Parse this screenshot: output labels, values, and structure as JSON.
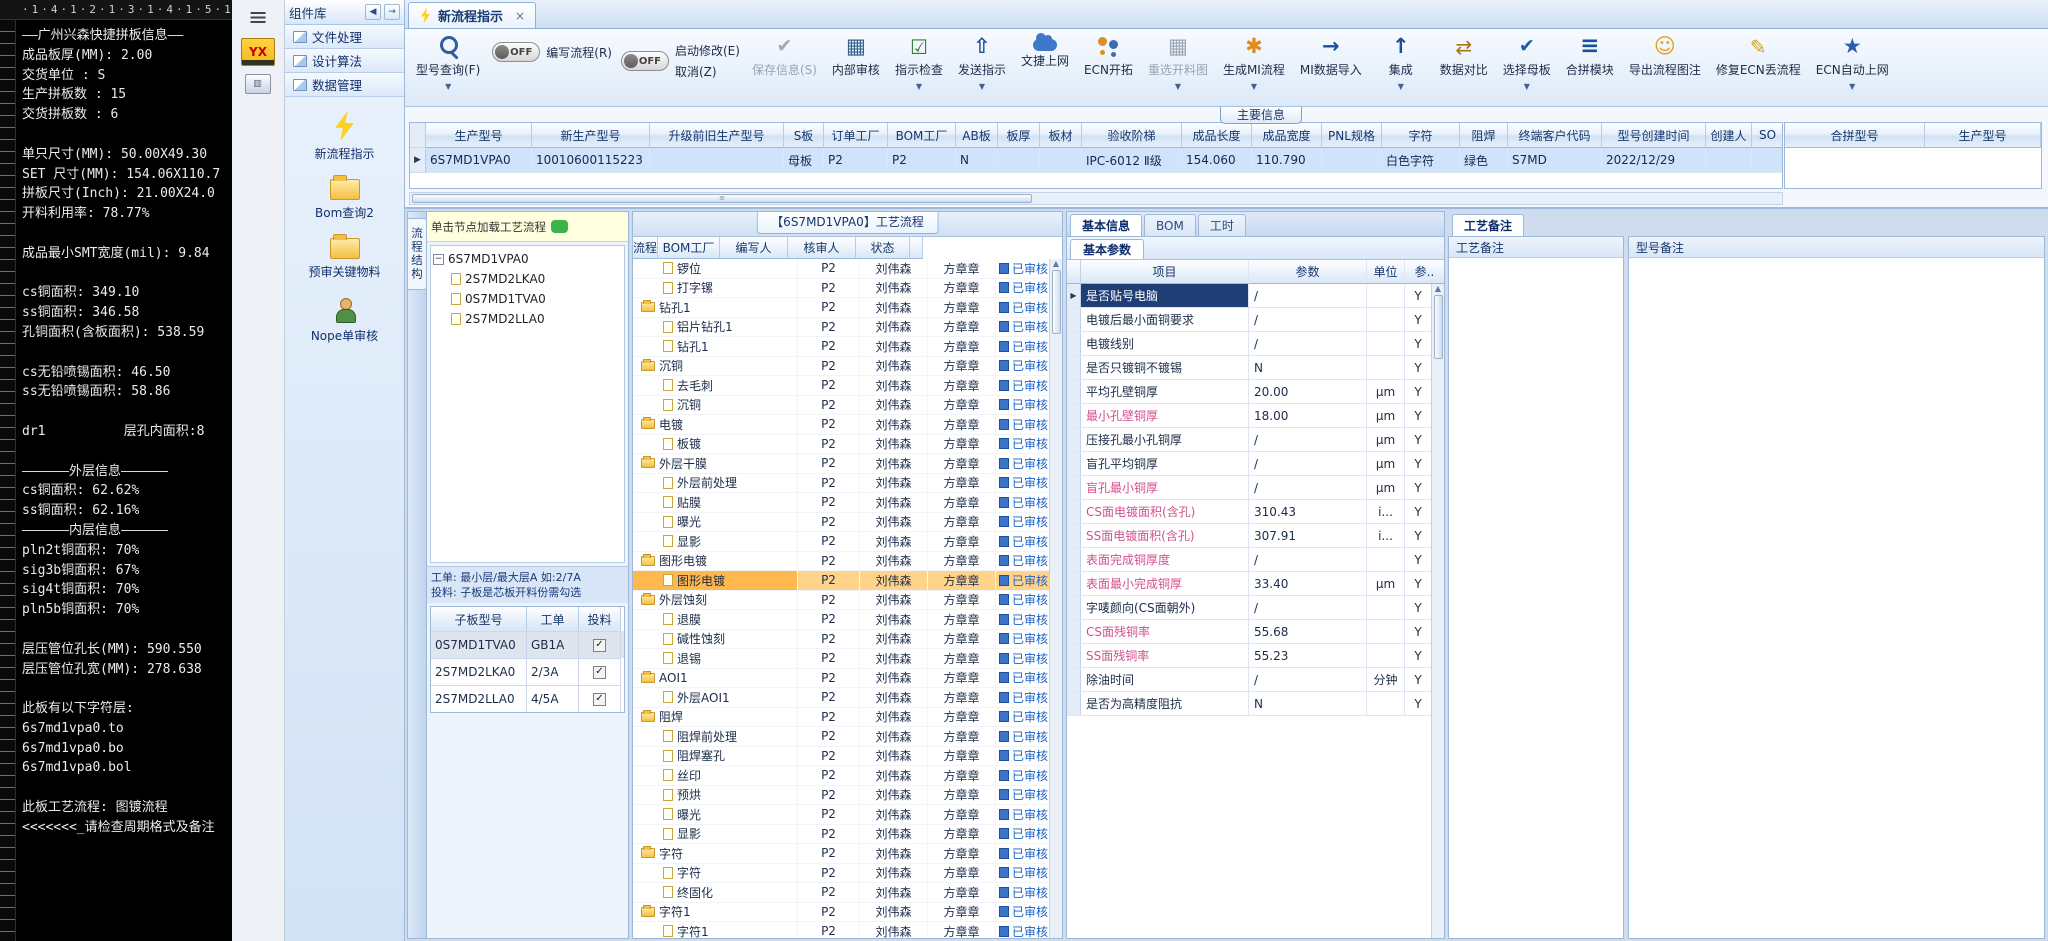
{
  "left_panel": {
    "ruler_text": "·1·4·1·2·1·3·1·4·1·5·1",
    "lines": [
      "——广州兴森快捷拼板信息——",
      "成品板厚(MM): 2.00",
      "交货单位 : S",
      "生产拼板数 : 15",
      "交货拼板数 : 6",
      "",
      "单只尺寸(MM): 50.00X49.30",
      "SET 尺寸(MM): 154.06X110.7",
      "拼板尺寸(Inch): 21.00X24.0",
      "开料利用率: 78.77%",
      "",
      "成品最小SMT宽度(mil): 9.84",
      "",
      "cs铜面积: 349.10",
      "ss铜面积: 346.58",
      "孔铜面积(含板面积): 538.59",
      "",
      "cs无铅喷锡面积: 46.50",
      "ss无铅喷锡面积: 58.86",
      "",
      "dr1          层孔内面积:8",
      "",
      "——————外层信息——————",
      "cs铜面积: 62.62%",
      "ss铜面积: 62.16%",
      "——————内层信息——————",
      "pln2t铜面积: 70%",
      "sig3b铜面积: 67%",
      "sig4t铜面积: 70%",
      "pln5b铜面积: 70%",
      "",
      "层压管位孔长(MM): 590.550",
      "层压管位孔宽(MM): 278.638",
      "",
      "此板有以下字符层:",
      "6s7md1vpa0.to",
      "6s7md1vpa0.bo",
      "6s7md1vpa0.bol",
      "",
      "此板工艺流程: 图镀流程",
      "<<<<<<<_请检查周期格式及备注"
    ]
  },
  "component_library": {
    "title": "组件库",
    "collapse_icon": "◀",
    "dock_icon": "→",
    "menu": [
      "文件处理",
      "设计算法",
      "数据管理"
    ],
    "tools": [
      {
        "label": "新流程指示",
        "icon": "lightning-icon"
      },
      {
        "label": "Bom查询2",
        "icon": "folder-icon"
      },
      {
        "label": "预审关键物料",
        "icon": "folder-icon"
      },
      {
        "label": "Nope单审核",
        "icon": "person-icon"
      }
    ]
  },
  "doc_tab": {
    "label": "新流程指示",
    "close": "×"
  },
  "toolbar": {
    "buttons": [
      {
        "label": "型号查询(F)",
        "icon": "search-icon",
        "dropdown": true
      },
      {
        "label": "编写流程(R)",
        "toggle": "OFF"
      },
      {
        "label": "启动修改(E)",
        "toggle": "OFF",
        "sub": "取消(Z)"
      },
      {
        "label": "保存信息(S)",
        "icon": "save-icon",
        "disabled": true
      },
      {
        "label": "内部审核",
        "icon": "print-icon"
      },
      {
        "label": "指示检查",
        "icon": "check-icon",
        "dropdown": true
      },
      {
        "label": "发送指示",
        "icon": "send-icon",
        "dropdown": true
      },
      {
        "label": "文捷上网",
        "icon": "cloud-icon"
      },
      {
        "label": "ECN开拓",
        "icon": "people-icon"
      },
      {
        "label": "重选开料图",
        "icon": "image-icon",
        "disabled": true,
        "dropdown": true
      },
      {
        "label": "生成MI流程",
        "icon": "gear-icon",
        "dropdown": true
      },
      {
        "label": "MI数据导入",
        "icon": "import-icon"
      },
      {
        "label": "集成",
        "icon": "up-icon",
        "dropdown": true
      },
      {
        "label": "数据对比",
        "icon": "compare-icon"
      },
      {
        "label": "选择母板",
        "icon": "select-icon",
        "dropdown": true
      },
      {
        "label": "合拼模块",
        "icon": "list-icon"
      },
      {
        "label": "导出流程图注",
        "icon": "smile-icon"
      },
      {
        "label": "修复ECN丢流程",
        "icon": "wrench-icon"
      },
      {
        "label": "ECN自动上网",
        "icon": "star-icon",
        "dropdown": true
      }
    ]
  },
  "main_section": {
    "label": "主要信息",
    "columns": [
      "生产型号",
      "新生产型号",
      "升级前旧生产型号",
      "S板",
      "订单工厂",
      "BOM工厂",
      "AB板",
      "板厚",
      "板材",
      "验收阶梯",
      "成品长度",
      "成品宽度",
      "PNL规格",
      "字符",
      "阻焊",
      "终端客户代码",
      "型号创建时间",
      "创建人",
      "SO"
    ],
    "row": [
      "6S7MD1VPA0",
      "10010600115223",
      "",
      "母板",
      "P2",
      "P2",
      "N",
      "",
      "",
      "IPC-6012 Ⅱ级",
      "154.060",
      "110.790",
      "",
      "白色字符",
      "绿色",
      "S7MD",
      "2022/12/29",
      "",
      ""
    ],
    "row_selector": "▶"
  },
  "merge_table": {
    "columns": [
      "合拼型号",
      "生产型号"
    ]
  },
  "sub_panel": {
    "vertical_tab": "流程结构",
    "note": "单击节点加载工艺流程",
    "tree_root": "6S7MD1VPA0",
    "tree_children": [
      "2S7MD2LKA0",
      "0S7MD1TVA0",
      "2S7MD2LLA0"
    ],
    "info_lines": [
      "工单: 最小层/最大层A 如:2/7A",
      "投料: 子板是芯板开料份需勾选"
    ],
    "table": {
      "columns": [
        "子板型号",
        "工单",
        "投料"
      ],
      "rows": [
        {
          "model": "0S7MD1TVA0",
          "order": "GB1A",
          "checked": true
        },
        {
          "model": "2S7MD2LKA0",
          "order": "2/3A",
          "checked": true
        },
        {
          "model": "2S7MD2LLA0",
          "order": "4/5A",
          "checked": true
        }
      ]
    }
  },
  "process_panel": {
    "title": "【6S7MD1VPA0】工艺流程",
    "columns": [
      "流程",
      "BOM工厂",
      "编写人",
      "核审人",
      "状态"
    ],
    "row_defaults": {
      "bom_factory": "P2",
      "writer": "刘伟森",
      "auditor": "方章章",
      "status": "已审核"
    },
    "rows": [
      {
        "name": "锣位",
        "level": 1,
        "icon": "doc"
      },
      {
        "name": "打字镙",
        "level": 1,
        "icon": "doc"
      },
      {
        "name": "钻孔1",
        "level": 0,
        "icon": "folder"
      },
      {
        "name": "铝片钻孔1",
        "level": 1,
        "icon": "doc"
      },
      {
        "name": "钻孔1",
        "level": 1,
        "icon": "doc"
      },
      {
        "name": "沉铜",
        "level": 0,
        "icon": "folder"
      },
      {
        "name": "去毛刺",
        "level": 1,
        "icon": "doc"
      },
      {
        "name": "沉铜",
        "level": 1,
        "icon": "doc"
      },
      {
        "name": "电镀",
        "level": 0,
        "icon": "folder"
      },
      {
        "name": "板镀",
        "level": 1,
        "icon": "doc"
      },
      {
        "name": "外层干膜",
        "level": 0,
        "icon": "folder"
      },
      {
        "name": "外层前处理",
        "level": 1,
        "icon": "doc"
      },
      {
        "name": "贴膜",
        "level": 1,
        "icon": "doc"
      },
      {
        "name": "曝光",
        "level": 1,
        "icon": "doc"
      },
      {
        "name": "显影",
        "level": 1,
        "icon": "doc"
      },
      {
        "name": "图形电镀",
        "level": 0,
        "icon": "folder"
      },
      {
        "name": "图形电镀",
        "level": 1,
        "icon": "doc",
        "highlighted": true
      },
      {
        "name": "外层蚀刻",
        "level": 0,
        "icon": "folder"
      },
      {
        "name": "退膜",
        "level": 1,
        "icon": "doc"
      },
      {
        "name": "碱性蚀刻",
        "level": 1,
        "icon": "doc"
      },
      {
        "name": "退锡",
        "level": 1,
        "icon": "doc"
      },
      {
        "name": "AOI1",
        "level": 0,
        "icon": "folder"
      },
      {
        "name": "外层AOI1",
        "level": 1,
        "icon": "doc"
      },
      {
        "name": "阻焊",
        "level": 0,
        "icon": "folder"
      },
      {
        "name": "阻焊前处理",
        "level": 1,
        "icon": "doc"
      },
      {
        "name": "阻焊塞孔",
        "level": 1,
        "icon": "doc"
      },
      {
        "name": "丝印",
        "level": 1,
        "icon": "doc"
      },
      {
        "name": "预烘",
        "level": 1,
        "icon": "doc"
      },
      {
        "name": "曝光",
        "level": 1,
        "icon": "doc"
      },
      {
        "name": "显影",
        "level": 1,
        "icon": "doc"
      },
      {
        "name": "字符",
        "level": 0,
        "icon": "folder"
      },
      {
        "name": "字符",
        "level": 1,
        "icon": "doc"
      },
      {
        "name": "终固化",
        "level": 1,
        "icon": "doc"
      },
      {
        "name": "字符1",
        "level": 0,
        "icon": "folder"
      },
      {
        "name": "字符1",
        "level": 1,
        "icon": "doc"
      }
    ]
  },
  "param_panel": {
    "tabs": [
      "基本信息",
      "BOM",
      "工时"
    ],
    "active_tab": "基本信息",
    "section": "基本参数",
    "columns": [
      "项目",
      "参数",
      "单位",
      "参.."
    ],
    "rows": [
      {
        "label": "是否贴号电脑",
        "value": "/",
        "unit": "",
        "flag": "Y",
        "selected": true
      },
      {
        "label": "电镀后最小面铜要求",
        "value": "/",
        "unit": "",
        "flag": "Y"
      },
      {
        "label": "电镀线别",
        "value": "/",
        "unit": "",
        "flag": "Y"
      },
      {
        "label": "是否只镀铜不镀锡",
        "value": "N",
        "unit": "",
        "flag": "Y"
      },
      {
        "label": "平均孔壁铜厚",
        "value": "20.00",
        "unit": "μm",
        "flag": "Y"
      },
      {
        "label": "最小孔壁铜厚",
        "value": "18.00",
        "unit": "μm",
        "flag": "Y",
        "pink": true
      },
      {
        "label": "压接孔最小孔铜厚",
        "value": "/",
        "unit": "μm",
        "flag": "Y"
      },
      {
        "label": "盲孔平均铜厚",
        "value": "/",
        "unit": "μm",
        "flag": "Y"
      },
      {
        "label": "盲孔最小铜厚",
        "value": "/",
        "unit": "μm",
        "flag": "Y",
        "pink": true
      },
      {
        "label": "CS面电镀面积(含孔)",
        "value": "310.43",
        "unit": "i...",
        "flag": "Y",
        "pink": true
      },
      {
        "label": "SS面电镀面积(含孔)",
        "value": "307.91",
        "unit": "i...",
        "flag": "Y",
        "pink": true
      },
      {
        "label": "表面完成铜厚度",
        "value": "/",
        "unit": "",
        "flag": "Y",
        "pink": true
      },
      {
        "label": "表面最小完成铜厚",
        "value": "33.40",
        "unit": "μm",
        "flag": "Y",
        "pink": true
      },
      {
        "label": "字唛颜向(CS面朝外)",
        "value": "/",
        "unit": "",
        "flag": "Y"
      },
      {
        "label": "CS面残铜率",
        "value": "55.68",
        "unit": "",
        "flag": "Y",
        "pink": true
      },
      {
        "label": "SS面残铜率",
        "value": "55.23",
        "unit": "",
        "flag": "Y",
        "pink": true
      },
      {
        "label": "除油时间",
        "value": "/",
        "unit": "分钟",
        "flag": "Y"
      },
      {
        "label": "是否为高精度阻抗",
        "value": "N",
        "unit": "",
        "flag": "Y"
      }
    ]
  },
  "notes": {
    "tab": "工艺备注",
    "left_title": "工艺备注",
    "right_title": "型号备注"
  }
}
